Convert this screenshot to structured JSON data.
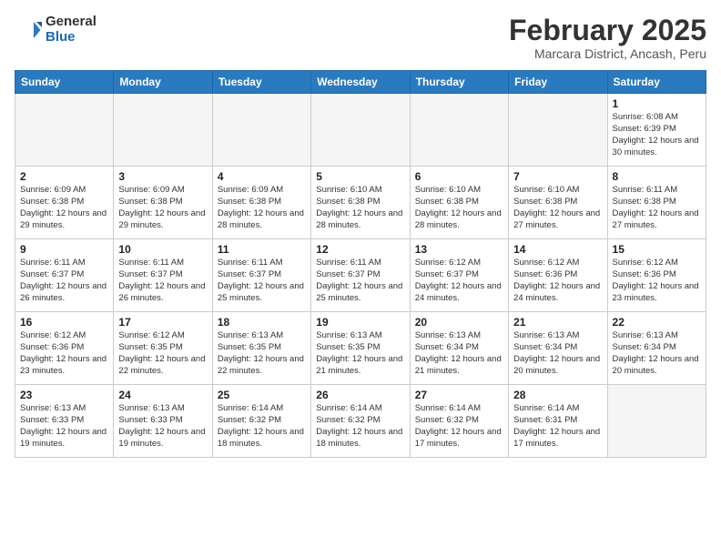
{
  "header": {
    "logo_general": "General",
    "logo_blue": "Blue",
    "month_title": "February 2025",
    "location": "Marcara District, Ancash, Peru"
  },
  "days_of_week": [
    "Sunday",
    "Monday",
    "Tuesday",
    "Wednesday",
    "Thursday",
    "Friday",
    "Saturday"
  ],
  "weeks": [
    [
      {
        "day": "",
        "info": ""
      },
      {
        "day": "",
        "info": ""
      },
      {
        "day": "",
        "info": ""
      },
      {
        "day": "",
        "info": ""
      },
      {
        "day": "",
        "info": ""
      },
      {
        "day": "",
        "info": ""
      },
      {
        "day": "1",
        "info": "Sunrise: 6:08 AM\nSunset: 6:39 PM\nDaylight: 12 hours and 30 minutes."
      }
    ],
    [
      {
        "day": "2",
        "info": "Sunrise: 6:09 AM\nSunset: 6:38 PM\nDaylight: 12 hours and 29 minutes."
      },
      {
        "day": "3",
        "info": "Sunrise: 6:09 AM\nSunset: 6:38 PM\nDaylight: 12 hours and 29 minutes."
      },
      {
        "day": "4",
        "info": "Sunrise: 6:09 AM\nSunset: 6:38 PM\nDaylight: 12 hours and 28 minutes."
      },
      {
        "day": "5",
        "info": "Sunrise: 6:10 AM\nSunset: 6:38 PM\nDaylight: 12 hours and 28 minutes."
      },
      {
        "day": "6",
        "info": "Sunrise: 6:10 AM\nSunset: 6:38 PM\nDaylight: 12 hours and 28 minutes."
      },
      {
        "day": "7",
        "info": "Sunrise: 6:10 AM\nSunset: 6:38 PM\nDaylight: 12 hours and 27 minutes."
      },
      {
        "day": "8",
        "info": "Sunrise: 6:11 AM\nSunset: 6:38 PM\nDaylight: 12 hours and 27 minutes."
      }
    ],
    [
      {
        "day": "9",
        "info": "Sunrise: 6:11 AM\nSunset: 6:37 PM\nDaylight: 12 hours and 26 minutes."
      },
      {
        "day": "10",
        "info": "Sunrise: 6:11 AM\nSunset: 6:37 PM\nDaylight: 12 hours and 26 minutes."
      },
      {
        "day": "11",
        "info": "Sunrise: 6:11 AM\nSunset: 6:37 PM\nDaylight: 12 hours and 25 minutes."
      },
      {
        "day": "12",
        "info": "Sunrise: 6:11 AM\nSunset: 6:37 PM\nDaylight: 12 hours and 25 minutes."
      },
      {
        "day": "13",
        "info": "Sunrise: 6:12 AM\nSunset: 6:37 PM\nDaylight: 12 hours and 24 minutes."
      },
      {
        "day": "14",
        "info": "Sunrise: 6:12 AM\nSunset: 6:36 PM\nDaylight: 12 hours and 24 minutes."
      },
      {
        "day": "15",
        "info": "Sunrise: 6:12 AM\nSunset: 6:36 PM\nDaylight: 12 hours and 23 minutes."
      }
    ],
    [
      {
        "day": "16",
        "info": "Sunrise: 6:12 AM\nSunset: 6:36 PM\nDaylight: 12 hours and 23 minutes."
      },
      {
        "day": "17",
        "info": "Sunrise: 6:12 AM\nSunset: 6:35 PM\nDaylight: 12 hours and 22 minutes."
      },
      {
        "day": "18",
        "info": "Sunrise: 6:13 AM\nSunset: 6:35 PM\nDaylight: 12 hours and 22 minutes."
      },
      {
        "day": "19",
        "info": "Sunrise: 6:13 AM\nSunset: 6:35 PM\nDaylight: 12 hours and 21 minutes."
      },
      {
        "day": "20",
        "info": "Sunrise: 6:13 AM\nSunset: 6:34 PM\nDaylight: 12 hours and 21 minutes."
      },
      {
        "day": "21",
        "info": "Sunrise: 6:13 AM\nSunset: 6:34 PM\nDaylight: 12 hours and 20 minutes."
      },
      {
        "day": "22",
        "info": "Sunrise: 6:13 AM\nSunset: 6:34 PM\nDaylight: 12 hours and 20 minutes."
      }
    ],
    [
      {
        "day": "23",
        "info": "Sunrise: 6:13 AM\nSunset: 6:33 PM\nDaylight: 12 hours and 19 minutes."
      },
      {
        "day": "24",
        "info": "Sunrise: 6:13 AM\nSunset: 6:33 PM\nDaylight: 12 hours and 19 minutes."
      },
      {
        "day": "25",
        "info": "Sunrise: 6:14 AM\nSunset: 6:32 PM\nDaylight: 12 hours and 18 minutes."
      },
      {
        "day": "26",
        "info": "Sunrise: 6:14 AM\nSunset: 6:32 PM\nDaylight: 12 hours and 18 minutes."
      },
      {
        "day": "27",
        "info": "Sunrise: 6:14 AM\nSunset: 6:32 PM\nDaylight: 12 hours and 17 minutes."
      },
      {
        "day": "28",
        "info": "Sunrise: 6:14 AM\nSunset: 6:31 PM\nDaylight: 12 hours and 17 minutes."
      },
      {
        "day": "",
        "info": ""
      }
    ]
  ]
}
